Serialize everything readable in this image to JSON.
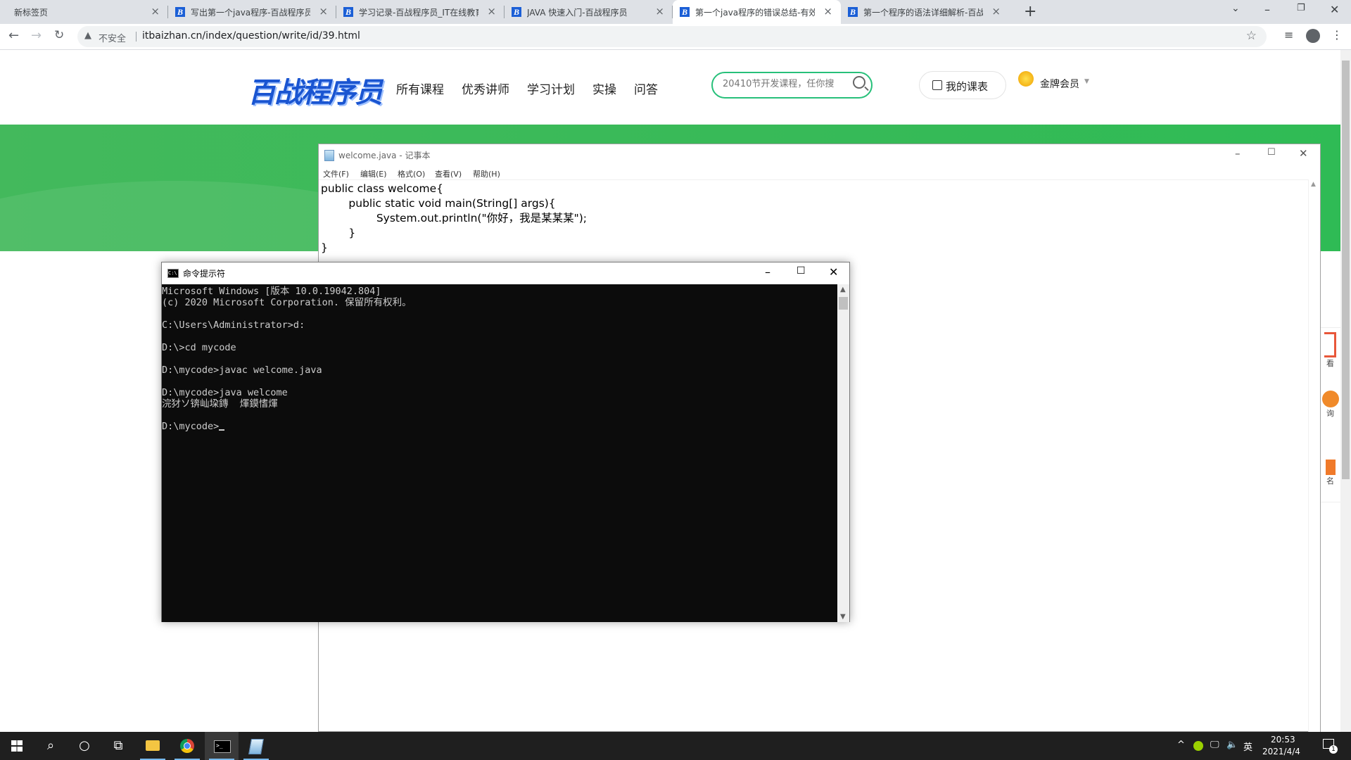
{
  "browser": {
    "tabs": [
      {
        "title": "新标签页",
        "favicon": false,
        "active": false
      },
      {
        "title": "写出第一个java程序-百战程序员",
        "favicon": true,
        "active": false
      },
      {
        "title": "学习记录-百战程序员_IT在线教育",
        "favicon": true,
        "active": false
      },
      {
        "title": "JAVA 快速入门-百战程序员",
        "favicon": true,
        "active": false
      },
      {
        "title": "第一个java程序的错误总结-有效",
        "favicon": true,
        "active": true
      },
      {
        "title": "第一个程序的语法详细解析-百战",
        "favicon": true,
        "active": false
      }
    ],
    "favicon_letter": "B",
    "new_tab_glyph": "+",
    "close_glyph": "×",
    "security_label": "不安全",
    "url": "itbaizhan.cn/index/question/write/id/39.html"
  },
  "site": {
    "logo_text": "百战程序员",
    "nav": [
      "所有课程",
      "优秀讲师",
      "学习计划",
      "实操",
      "问答"
    ],
    "search_placeholder": "20410节开发课程，任你搜",
    "my_courses": "我的课表",
    "member": "金牌会员",
    "right_widgets": [
      "看",
      "询",
      "名"
    ],
    "accent_color": "#27c07a"
  },
  "notepad": {
    "title": "welcome.java - 记事本",
    "menu": [
      "文件(F)",
      "编辑(E)",
      "格式(O)",
      "查看(V)",
      "帮助(H)"
    ],
    "content": "public class welcome{\n\tpublic static void main(String[] args){\n\t\tSystem.out.println(\"你好，我是某某某\");\n\t}\n}"
  },
  "cmd": {
    "title": "命令提示符",
    "output": "Microsoft Windows [版本 10.0.19042.804]\n(c) 2020 Microsoft Corporation. 保留所有权利。\n\nC:\\Users\\Administrator>d:\n\nD:\\>cd mycode\n\nD:\\mycode>javac welcome.java\n\nD:\\mycode>java welcome\n浣犲ソ锛屾垜鏄  煇鏌愭煇\n\nD:\\mycode>"
  },
  "taskbar": {
    "ime": "英",
    "time": "20:53",
    "date": "2021/4/4",
    "notification_count": "1"
  }
}
